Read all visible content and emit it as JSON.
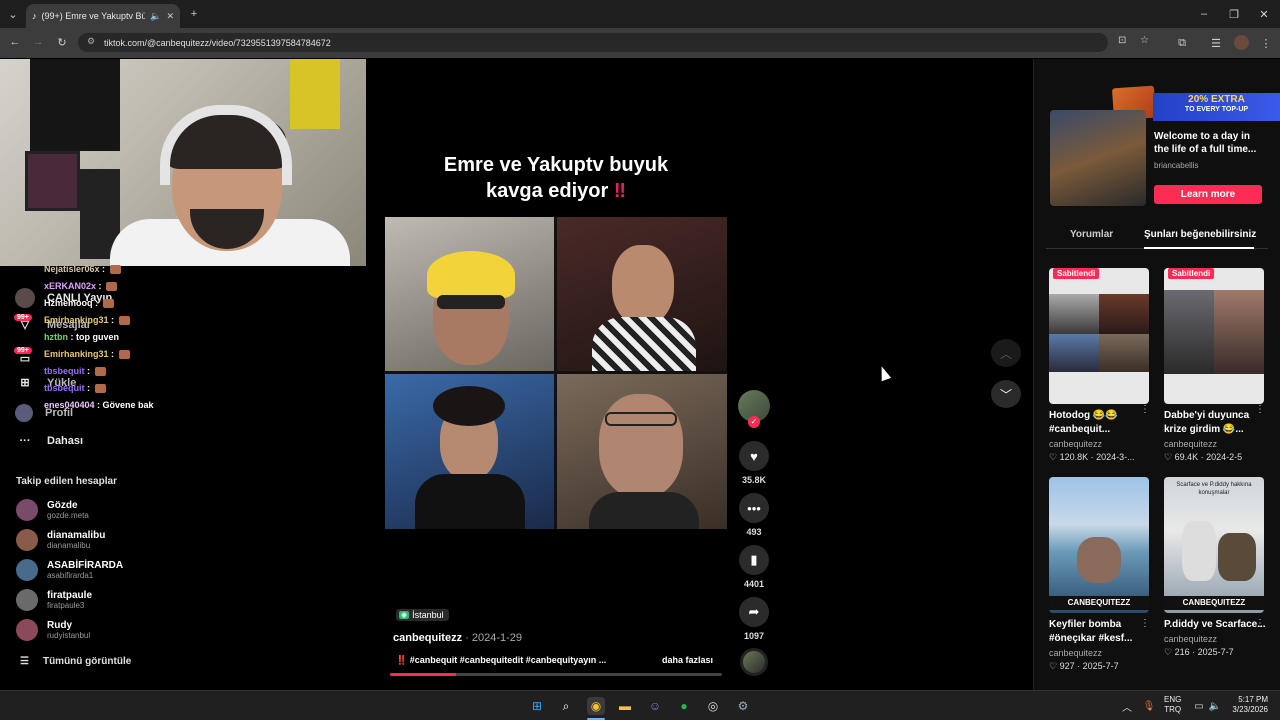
{
  "browser": {
    "tab_title": "(99+) Emre ve Yakuptv Büyü",
    "url": "tiktok.com/@canbequitezz/video/7329551397584784672"
  },
  "sidebar": {
    "nav": [
      {
        "label": "CANLI Yayın",
        "icon": "live-icon"
      },
      {
        "label": "Mesajlar",
        "icon": "messages-icon"
      },
      {
        "label": "Gelen Kutusu",
        "icon": "inbox-icon"
      },
      {
        "label": "Yükle",
        "icon": "upload-icon"
      },
      {
        "label": "Profil",
        "icon": "profile-icon"
      },
      {
        "label": "Dahası",
        "icon": "more-icon"
      }
    ],
    "badge": "99+",
    "following_header": "Takip edilen hesaplar",
    "accounts": [
      {
        "name": "Gözde",
        "handle": "gozde.meta",
        "color": "#7a4a6a"
      },
      {
        "name": "dianamalibu",
        "handle": "dianamalibu",
        "color": "#8a5a4a"
      },
      {
        "name": "ASABİFİRARDA",
        "handle": "asabifirarda1",
        "color": "#4a6a8a"
      },
      {
        "name": "firatpaule",
        "handle": "firatpaule3",
        "color": "#6a6a6a"
      },
      {
        "name": "Rudy",
        "handle": "rudyistanbul",
        "color": "#8a4a5a"
      }
    ],
    "see_all": "Tümünü görüntüle"
  },
  "chat": [
    {
      "user": "Nejatisler06x",
      "msg": "",
      "color": "#d8c8a8"
    },
    {
      "user": "xERKAN02x",
      "msg": "",
      "color": "#e0a0ff"
    },
    {
      "user": "Hzmemooq",
      "msg": "",
      "color": "#ffffff"
    },
    {
      "user": "Emirhanking31",
      "msg": "",
      "color": "#e8c878"
    },
    {
      "user": "hztbn",
      "msg": "top guven",
      "color": "#6cd86c"
    },
    {
      "user": "Emirhanking31",
      "msg": "",
      "color": "#e8c878"
    },
    {
      "user": "tbsbequit",
      "msg": "",
      "color": "#9a6cff"
    },
    {
      "user": "tbsbequit",
      "msg": "",
      "color": "#9a6cff"
    },
    {
      "user": "enes040404",
      "msg": "Gövene bak",
      "color": "#e8c8ff"
    }
  ],
  "video": {
    "overlay_title_line1": "Emre ve Yakuptv buyuk",
    "overlay_title_line2": "kavga ediyor",
    "location": "İstanbul",
    "author": "canbequitezz",
    "date": "2024-1-29",
    "caption": "‼️ #canbequit #canbequitedit #canbequityayın ...",
    "more": "daha fazlası",
    "progress": 0.2
  },
  "actions": {
    "likes": "35.8K",
    "comments": "493",
    "saves": "4401",
    "shares": "1097"
  },
  "ad": {
    "banner_line1": "20% EXTRA",
    "banner_line2": "TO EVERY TOP-UP",
    "title": "Welcome to a day in the life of a full time...",
    "user": "briancabellis",
    "cta": "Learn more"
  },
  "right_tabs": {
    "comments": "Yorumlar",
    "suggested": "Şunları beğenebilirsiniz"
  },
  "suggestions": [
    {
      "pinned": "Sabitlendi",
      "title": "Hotodog 😂😂 #canbequit...",
      "user": "canbequitezz",
      "likes": "120.8K",
      "date": "2024-3-..."
    },
    {
      "pinned": "Sabitlendi",
      "title": "Dabbe'yi duyunca krize girdim 😂...",
      "user": "canbequitezz",
      "likes": "69.4K",
      "date": "2024-2-5"
    },
    {
      "pinned": "",
      "title": "Keyfiler bomba #öneçıkar #kesf...",
      "user": "canbequitezz",
      "likes": "927",
      "date": "2025-7-7",
      "thumb_text": "CANBEQUITEZZ"
    },
    {
      "pinned": "",
      "title": "P.diddy ve Scarface...",
      "user": "canbequitezz",
      "likes": "216",
      "date": "2025-7-7",
      "thumb_text": "CANBEQUITEZZ",
      "thumb_caption": "Scarface ve P.diddy hakkına konuşmalar"
    }
  ],
  "taskbar": {
    "lang1": "ENG",
    "lang2": "TRQ",
    "time": "5:17 PM",
    "date": "3/23/2026"
  },
  "colors": {
    "accent": "#fe2c55",
    "background": "#000000",
    "panel": "#0f0f0f"
  }
}
